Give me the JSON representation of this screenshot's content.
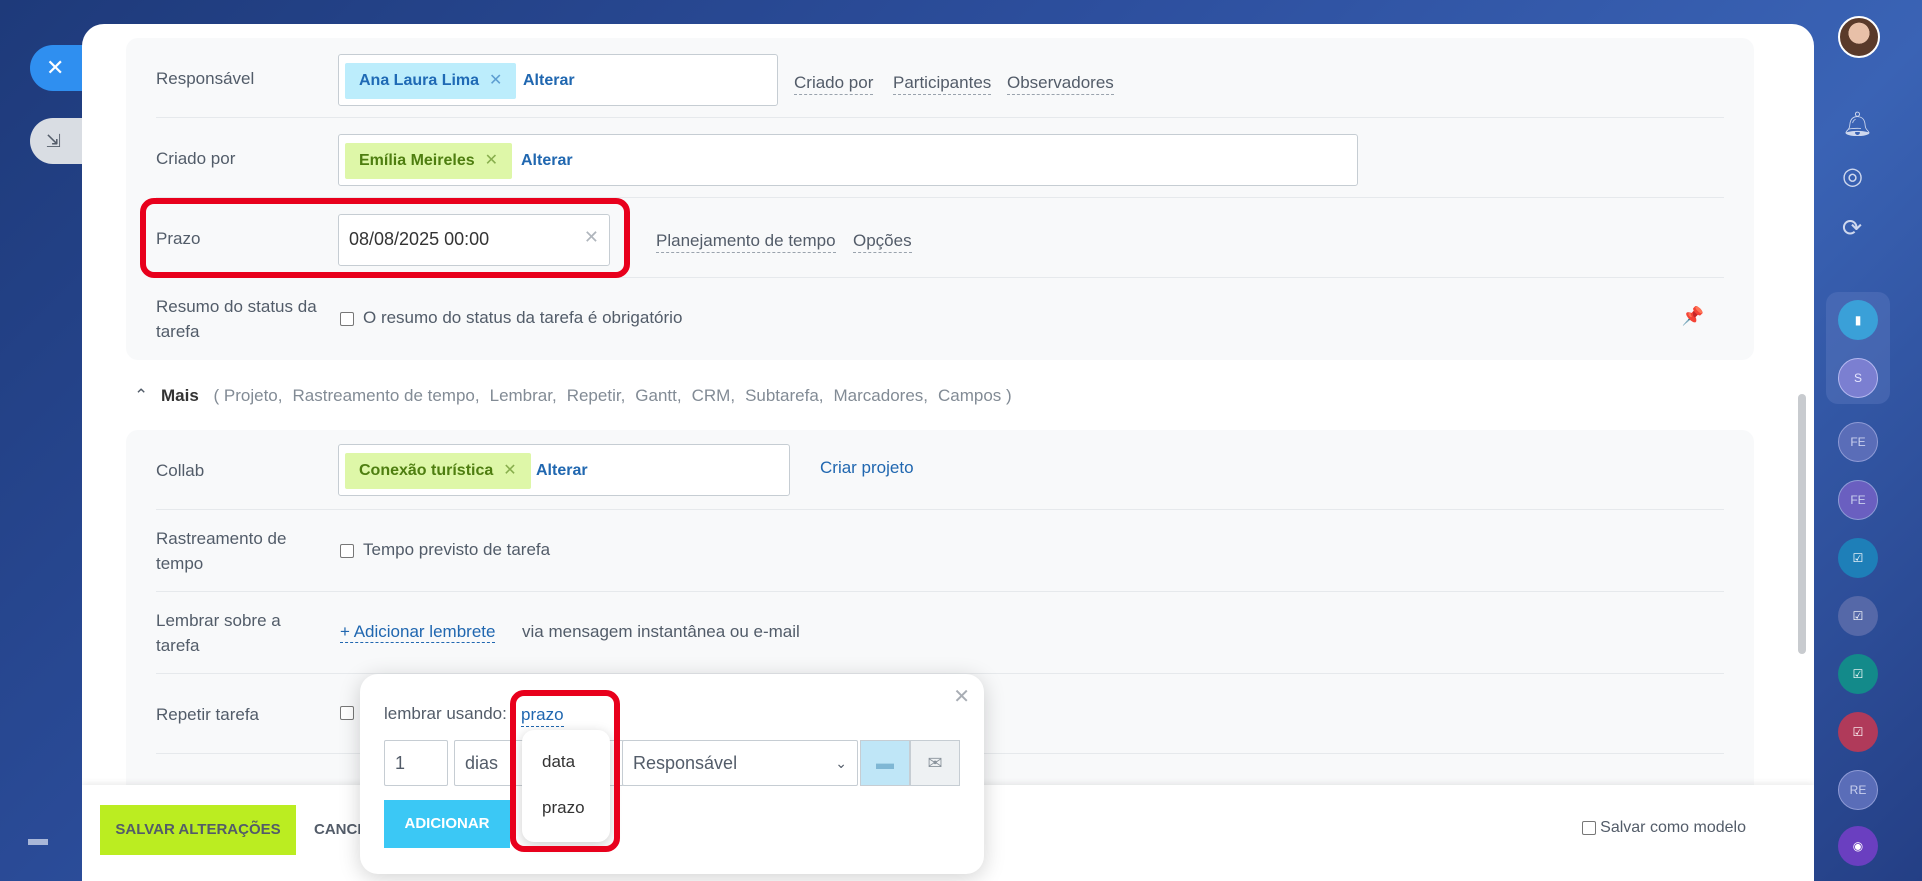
{
  "fields": {
    "responsavel": {
      "label": "Responsável",
      "tag": "Ana Laura Lima",
      "change": "Alterar"
    },
    "criado_por": {
      "label": "Criado por",
      "tag": "Emília Meireles",
      "change": "Alterar"
    },
    "prazo": {
      "label": "Prazo",
      "value": "08/08/2025 00:00"
    },
    "resumo": {
      "label": "Resumo do status da tarefa",
      "checkbox_label": "O resumo do status da tarefa é obrigatório"
    }
  },
  "header_links": {
    "criado_por": "Criado por",
    "participantes": "Participantes",
    "observadores": "Observadores"
  },
  "prazo_links": {
    "planejamento": "Planejamento de tempo",
    "opcoes": "Opções"
  },
  "more": {
    "title": "Mais",
    "items": [
      "( Projeto,",
      "Rastreamento de tempo,",
      "Lembrar,",
      "Repetir,",
      "Gantt,",
      "CRM,",
      "Subtarefa,",
      "Marcadores,",
      "Campos )"
    ]
  },
  "extra": {
    "collab": {
      "label": "Collab",
      "tag": "Conexão turística",
      "change": "Alterar",
      "create": "Criar projeto"
    },
    "rastreamento": {
      "label": "Rastreamento de tempo",
      "checkbox_label": "Tempo previsto de tarefa"
    },
    "lembrar": {
      "label": "Lembrar sobre a tarefa",
      "link": "+ Adicionar lembrete",
      "suffix": "via mensagem instantânea ou e-mail"
    },
    "repetir": {
      "label": "Repetir tarefa"
    }
  },
  "popup": {
    "label": "lembrar usando:",
    "mode_link": "prazo",
    "amount": "1",
    "unit": "dias",
    "recipient": "Responsável",
    "add_button": "ADICIONAR",
    "dropdown_options": [
      "data",
      "prazo"
    ]
  },
  "footer": {
    "save": "SALVAR ALTERAÇÕES",
    "cancel": "CANCE",
    "save_template": "Salvar como modelo"
  },
  "sidebar": {
    "avatars": [
      "S",
      "FE",
      "FE",
      "RE"
    ]
  }
}
